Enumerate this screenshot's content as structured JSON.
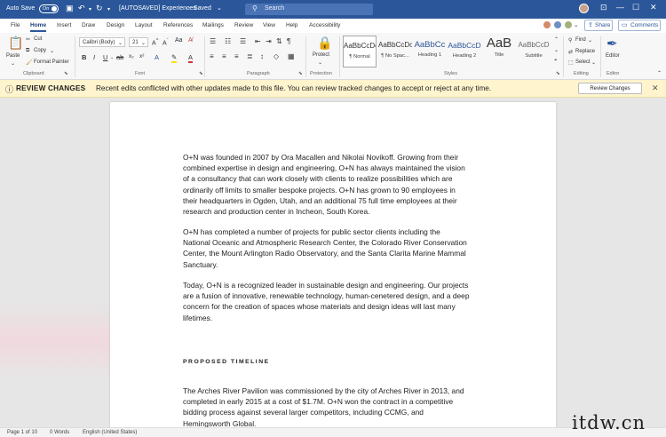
{
  "titlebar": {
    "autosave_label": "Auto Save",
    "autosave_state": "On",
    "doc_title": "[AUTOSAVED] Experiences",
    "saved_status": "Saved",
    "search_placeholder": "Search"
  },
  "menu": {
    "tabs": [
      "File",
      "Home",
      "Insert",
      "Draw",
      "Design",
      "Layout",
      "References",
      "Mailings",
      "Review",
      "View",
      "Help",
      "Accessibility"
    ],
    "active_tab": "Home",
    "share_label": "Share",
    "comments_label": "Comments"
  },
  "ribbon": {
    "clipboard": {
      "paste": "Paste",
      "cut": "Cut",
      "copy": "Copy",
      "format_painter": "Format Painter",
      "group": "Clipboard"
    },
    "font": {
      "family": "Calibri (Body)",
      "size": "21",
      "group": "Font"
    },
    "paragraph": {
      "group": "Paragraph"
    },
    "protection": {
      "protect": "Protect",
      "group": "Protection"
    },
    "styles": {
      "group": "Styles",
      "items": [
        {
          "preview": "AaBbCcDc",
          "name": "¶ Normal"
        },
        {
          "preview": "AaBbCcDc",
          "name": "¶ No Spac..."
        },
        {
          "preview": "AaBbCc",
          "name": "Heading 1"
        },
        {
          "preview": "AaBbCcD",
          "name": "Heading 2"
        },
        {
          "preview": "AaB",
          "name": "Title"
        },
        {
          "preview": "AaBbCcD",
          "name": "Subtitle"
        }
      ]
    },
    "editing": {
      "find": "Find",
      "replace": "Replace",
      "select": "Select",
      "group": "Editing"
    },
    "editor": {
      "label": "Editor",
      "group": "Editor"
    }
  },
  "alert": {
    "title": "REVIEW CHANGES",
    "message": "Recent edits conflicted with other updates made to this file. You can review tracked changes to accept or reject at any time.",
    "button": "Review Changes"
  },
  "document": {
    "paragraphs": [
      [
        "O+N was founded in 2007 by Ora Macallen and Nikolai Novikoff. Growing from their",
        "combined expertise in design and engineering, O+N has always maintained the vision",
        "of a consultancy that can work closely with clients to realize possibilities which are",
        "ordinarily off limits to smaller bespoke projects. O+N has grown to 90 employees in",
        "their headquarters in Ogden, Utah, and an additional 75 full time employees at their",
        "research and production center in Incheon, South Korea."
      ],
      [
        "O+N has completed a number of projects for public sector clients including the",
        "National Oceanic and Atmospheric Research Center, the Colorado River Conservation",
        "Center, the Mount Arlington Radio Observatory, and the Santa Clarita Marine Mammal",
        "Sanctuary."
      ],
      [
        "Today, O+N is a recognized leader in sustainable design and engineering. Our projects",
        "are a fusion of innovative, renewable technology, human-cenetered design, and a deep",
        "concern for the creation of spaces whose materials and design ideas will last many",
        "lifetimes."
      ]
    ],
    "heading": "PROPOSED TIMELINE",
    "timeline_paragraph": [
      "The Arches River Pavilion was commissioned by the city of Arches River in 2013, and",
      "completed in early 2015 at a cost of $1.7M. O+N won the contract in a competitive",
      "bidding process against several larger competitors, including CCMG, and",
      "Hemingsworth Global."
    ]
  },
  "statusbar": {
    "page": "Page 1 of 10",
    "words": "0 Words",
    "language": "English (United States)"
  },
  "watermark": "itdw.cn",
  "colors": {
    "word_blue": "#2b579a",
    "alert_bg": "#fff4ce"
  }
}
